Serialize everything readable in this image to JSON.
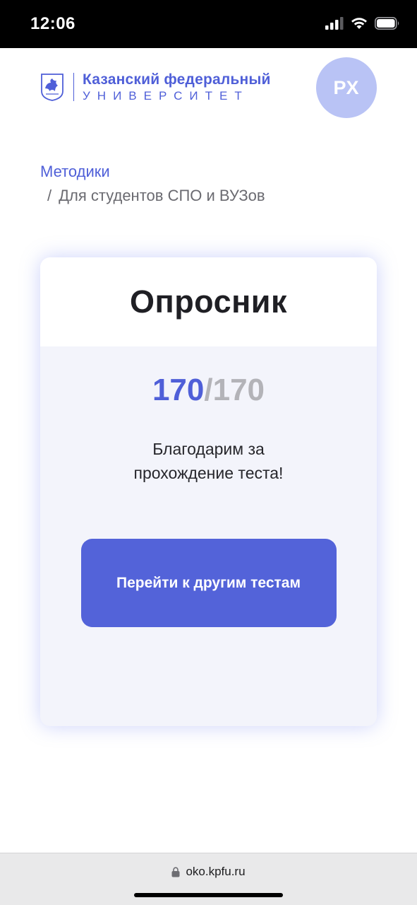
{
  "status_bar": {
    "time": "12:06",
    "icons": [
      "cellular-signal-icon",
      "wifi-icon",
      "battery-icon"
    ]
  },
  "header": {
    "logo": {
      "line1": "Казанский федеральный",
      "line2": "УНИВЕРСИТЕТ"
    },
    "avatar_initials": "РХ"
  },
  "breadcrumb": {
    "parent": "Методики",
    "separator": "/",
    "current": "Для студентов СПО и ВУЗов"
  },
  "card": {
    "title": "Опросник",
    "score": {
      "done": "170",
      "separator": "/",
      "total": "170"
    },
    "message": "Благодарим за прохождение теста!",
    "button_label": "Перейти к другим тестам"
  },
  "browser": {
    "url": "oko.kpfu.ru",
    "icon": "lock-icon"
  },
  "colors": {
    "accent": "#4f5fd8",
    "button": "#5363d9",
    "avatar_bg": "#b9c3f5",
    "card_bg": "#f3f4fb",
    "muted": "#b3b3b8"
  }
}
